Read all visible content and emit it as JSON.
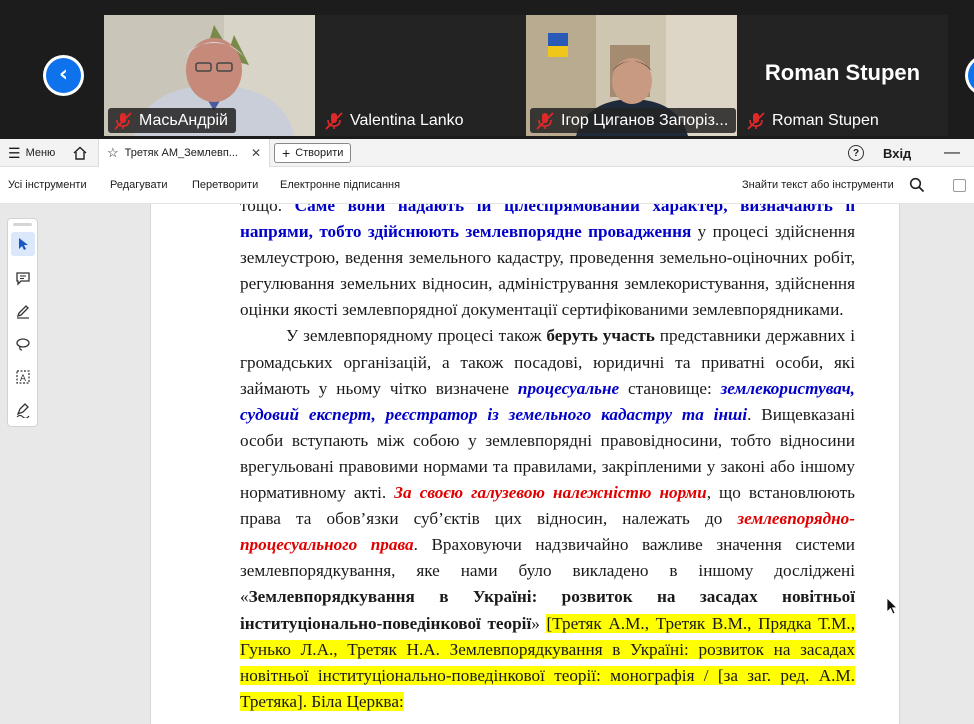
{
  "conference": {
    "participants": [
      {
        "name": "МасьАндрій",
        "muted": true,
        "video": true
      },
      {
        "name": "Valentina Lanko",
        "muted": true,
        "video": false
      },
      {
        "name": "Ігор Циганов Запоріз...",
        "muted": true,
        "video": true
      },
      {
        "name": "Roman Stupen",
        "muted": true,
        "video": false,
        "display_name": "Roman Stupen"
      }
    ],
    "colors": {
      "accent": "#0e72ed",
      "mic_muted": "#e02828"
    }
  },
  "tabbar": {
    "menu_label": "Меню",
    "doc_tab_title": "Третяк АМ_Землевп...",
    "create_label": "Створити",
    "help_label": "?",
    "signin_label": "Вхід"
  },
  "toolbar": {
    "all_tools": "Усі інструменти",
    "edit": "Редагувати",
    "convert": "Перетворити",
    "esign": "Електронне підписання",
    "search": "Знайти текст або інструменти"
  },
  "tools": [
    "select-tool",
    "comment-tool",
    "draw-tool",
    "lasso-tool",
    "text-recognition-tool",
    "sign-tool"
  ],
  "document": {
    "p1": {
      "lead": "тощо. ",
      "blue": "Саме вони надають їй цілеспрямований характер, визначають її напрями, тобто здійснюють землевпорядне провадження",
      "tail": " у процесі здійснення землеустрою, ведення земельного кадастру, проведення земельно-оціночних робіт, регулювання земельних відносин, адміністрування землекористування, здійснення оцінки якості землевпорядної документації сертифікованими землевпорядниками."
    },
    "p2": {
      "s1": "У землевпорядному процесі також ",
      "b1": "беруть участь",
      "s2": " представники державних і громадських організацій, а також посадові, юридичні та приватні особи, які займають у ньому чітко визначене ",
      "blue1": "процесуальне",
      "s3": " становище: ",
      "blue2": "землекористувач, судовий експерт, реєстратор із земельного кадастру та інші",
      "s4": ". Вищевказані особи вступають між собою у землевпорядні правовідносини, тобто відносини врегульовані правовими нормами та правилами, закріпленими у законі або іншому нормативному акті. ",
      "red1": "За своєю галузевою належністю норми",
      "s5": ", що встановлюють права та обов’язки суб’єктів цих відносин, належать до ",
      "red2": "землевпорядно-процесуального права",
      "s6": ". Враховуючи надзвичайно важливе значення системи землевпорядкування, яке нами було викладено в іншому досліджені «",
      "b2": "Землевпорядкування в Україні: розвиток на засадах новітньої інституціонально-поведінкової теорії",
      "s7": "» ",
      "yellow": "[Третяк А.М., Третяк В.М., Прядка Т.М., Гунько Л.А., Третяк Н.А. Землевпорядкування в Україні: розвиток на засадах новітньої інституціонально-поведінкової теорії: монографія / [за заг. ред. А.М. Третяка]. Біла Церква:"
    }
  }
}
